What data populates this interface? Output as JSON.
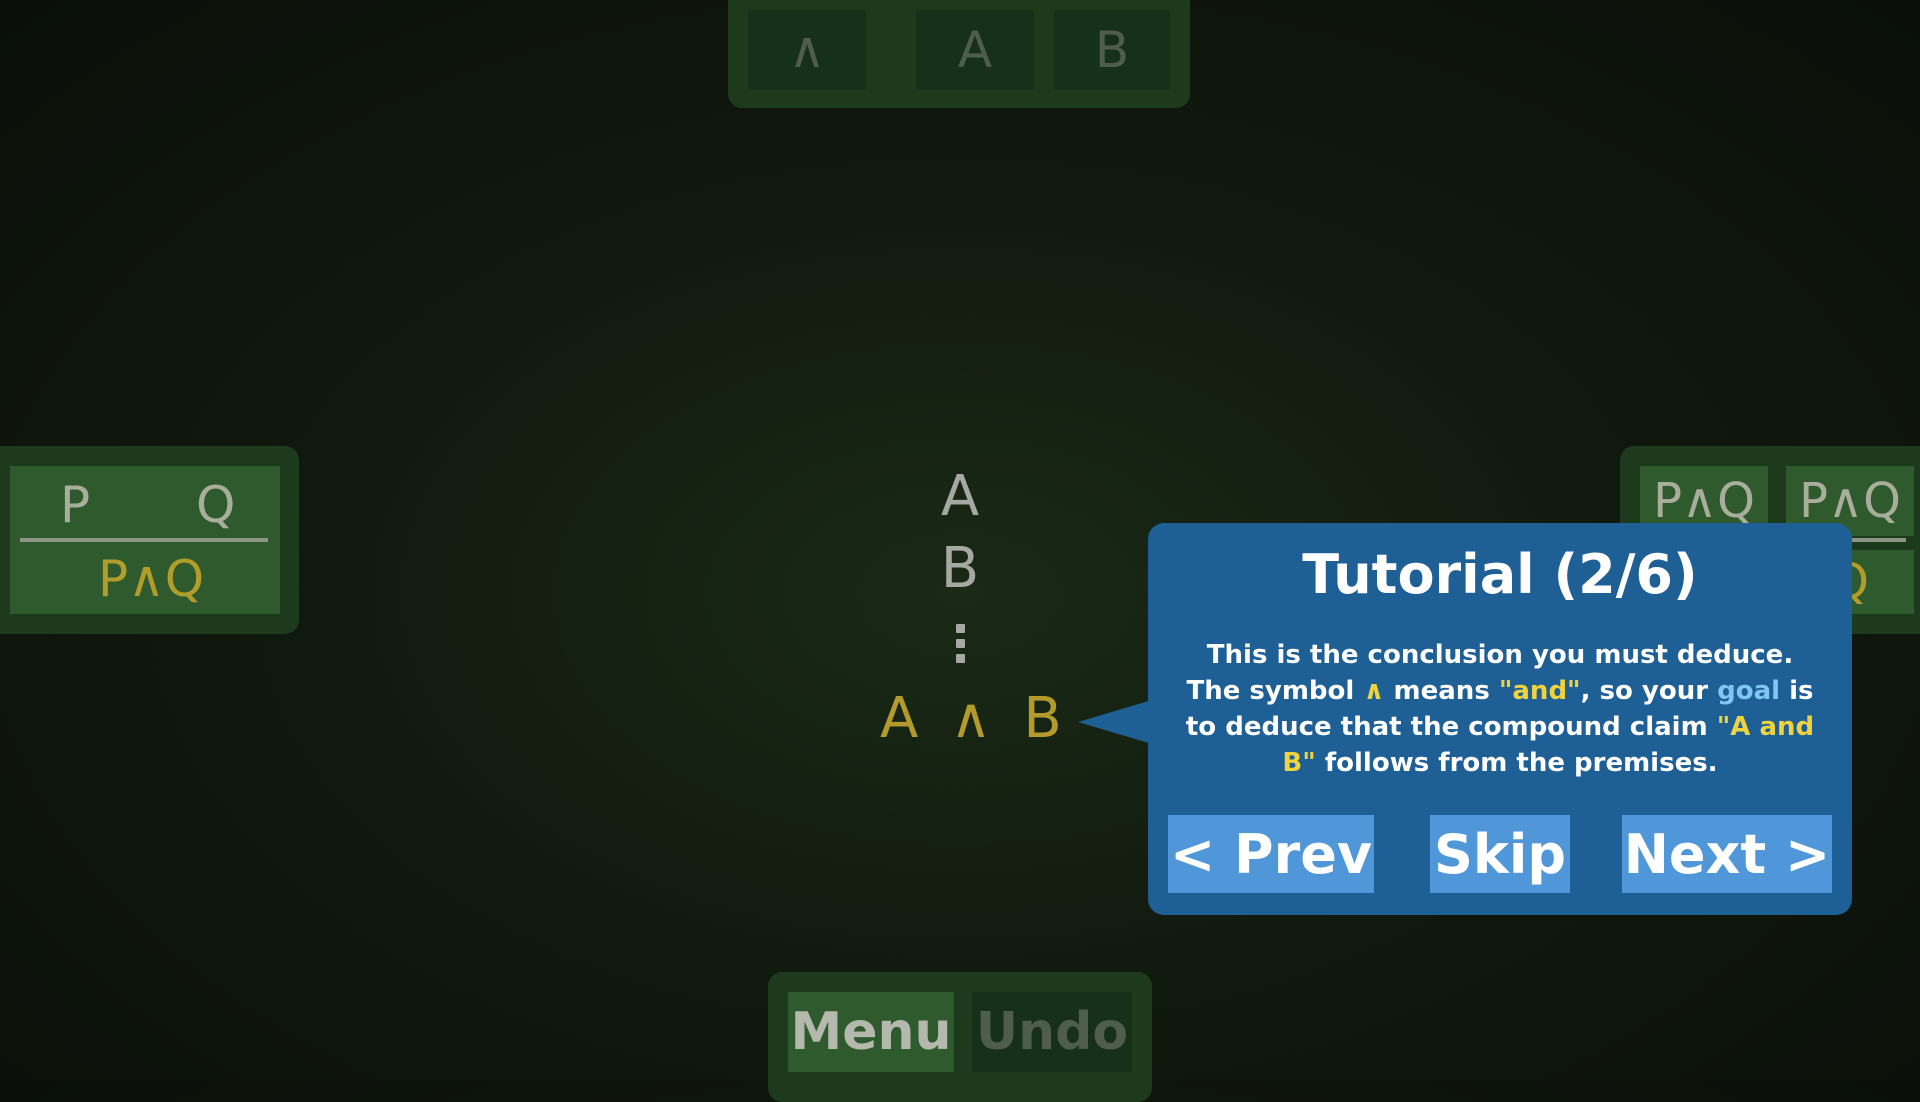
{
  "top_bar": {
    "tiles": [
      "∧",
      "A",
      "B"
    ]
  },
  "rule_left": {
    "premise_left": "P",
    "premise_right": "Q",
    "result": "P∧Q"
  },
  "rule_right": {
    "tiles": [
      "P∧Q",
      "P∧Q"
    ],
    "peek": "Q"
  },
  "proof": {
    "premises": [
      "A",
      "B"
    ],
    "goal": [
      "A",
      "∧",
      "B"
    ]
  },
  "tutorial": {
    "title": "Tutorial (2/6)",
    "body": {
      "p1": "This is the conclusion you must deduce. The symbol ",
      "sym": "∧",
      "p2": " means ",
      "and_q": "\"and\"",
      "p3": ", so your ",
      "goal_word": "goal",
      "p4": " is to deduce that the compound claim ",
      "claim": "\"A and B\"",
      "p5": " follows from the premises."
    },
    "prev_label": "< Prev",
    "skip_label": "Skip",
    "next_label": "Next >"
  },
  "bottom_bar": {
    "menu_label": "Menu",
    "undo_label": "Undo"
  },
  "colors": {
    "panel": "#1d3a1c",
    "popup": "#1e5f96",
    "button": "#4f97d8",
    "gold": "#b39a2b"
  }
}
